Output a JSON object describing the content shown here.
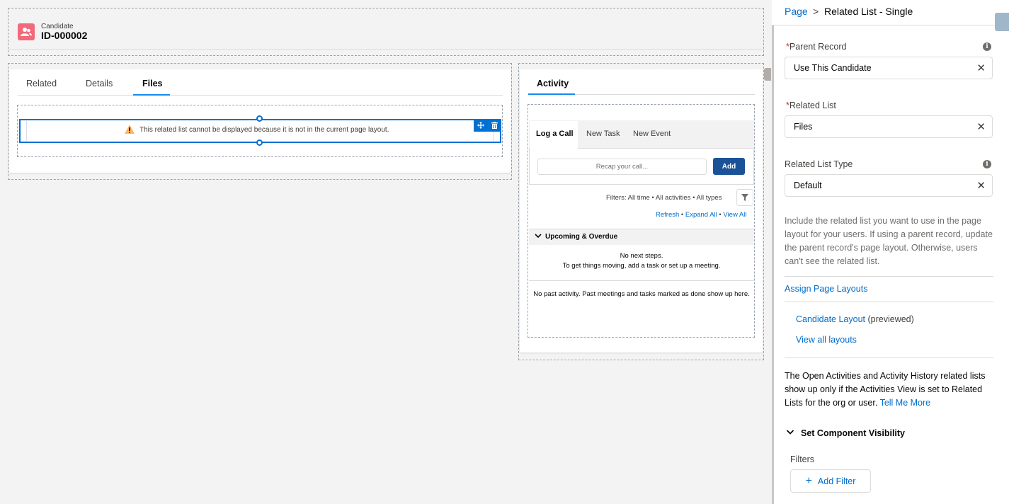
{
  "record": {
    "object_label": "Candidate",
    "name": "ID-000002",
    "icon": "candidate-icon"
  },
  "left_tabs": [
    {
      "label": "Related"
    },
    {
      "label": "Details"
    },
    {
      "label": "Files"
    }
  ],
  "active_left_tab": "Files",
  "warning_text": "This related list cannot be displayed because it is not in the current page layout.",
  "activity": {
    "tab_label": "Activity",
    "composer_tabs": [
      {
        "label": "Log a Call"
      },
      {
        "label": "New Task"
      },
      {
        "label": "New Event"
      }
    ],
    "recap_placeholder": "Recap your call...",
    "add_label": "Add",
    "filters_text": "Filters: All time • All activities • All types",
    "refresh_label": "Refresh",
    "expand_all_label": "Expand All",
    "view_all_label": "View All",
    "upcoming_label": "Upcoming & Overdue",
    "no_next_steps": "No next steps.",
    "no_next_steps_hint": "To get things moving, add a task or set up a meeting.",
    "no_past_activity": "No past activity. Past meetings and tasks marked as done show up here."
  },
  "panel": {
    "breadcrumb_page": "Page",
    "breadcrumb_separator": ">",
    "title": "Related List - Single",
    "parent_record_label": "Parent Record",
    "parent_record_value": "Use This Candidate",
    "related_list_label": "Related List",
    "related_list_value": "Files",
    "related_list_type_label": "Related List Type",
    "related_list_type_value": "Default",
    "required_marker": "*",
    "help_text": "Include the related list you want to use in the page layout for your users. If using a parent record, update the parent record's page layout. Otherwise, users can't see the related list.",
    "assign_layouts_label": "Assign Page Layouts",
    "candidate_layout_label": "Candidate Layout",
    "previewed_label": "(previewed)",
    "view_all_layouts_label": "View all layouts",
    "activities_note": "The Open Activities and Activity History related lists show up only if the Activities View is set to Related Lists for the org or user.",
    "tell_me_more_label": "Tell Me More",
    "visibility_section_label": "Set Component Visibility",
    "filters_label": "Filters",
    "add_filter_label": "Add Filter"
  },
  "colors": {
    "accent": "#0070d2",
    "link": "#006dcc",
    "record_icon": "#f26979",
    "add_button": "#1b5297"
  }
}
